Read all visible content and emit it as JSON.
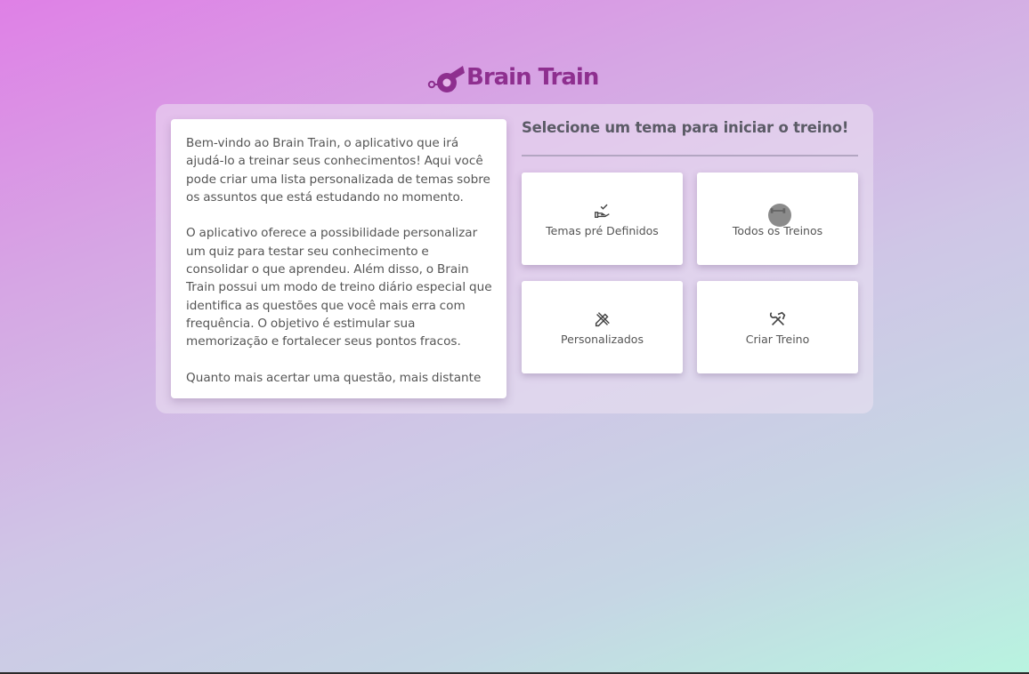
{
  "app": {
    "name": "Brain Train",
    "logo_icon": "whistle-icon",
    "brand_color": "#8e2f8f"
  },
  "intro": {
    "paragraphs": "Bem-vindo ao Brain Train, o aplicativo que irá ajudá-lo a treinar seus conhecimentos! Aqui você pode criar uma lista personalizada de temas sobre os assuntos que está estudando no momento.\n\nO aplicativo oferece a possibilidade personalizar um quiz para testar seu conhecimento e consolidar o que aprendeu. Além disso, o Brain Train possui um modo de treino diário especial que identifica as questões que você mais erra com frequência. O objetivo é estimular sua memorização e fortalecer seus pontos fracos.\n\nQuanto mais acertar uma questão, mais distante"
  },
  "selection": {
    "heading": "Selecione um tema para iniciar o treino!",
    "tiles": [
      {
        "label": "Temas pré Definidos",
        "icon": "hand-check-icon"
      },
      {
        "label": "Todos os Treinos",
        "icon": "dumbbell-icon"
      },
      {
        "label": "Personalizados",
        "icon": "pencil-ruler-icon"
      },
      {
        "label": "Criar Treino",
        "icon": "hammer-wrench-icon"
      }
    ]
  }
}
